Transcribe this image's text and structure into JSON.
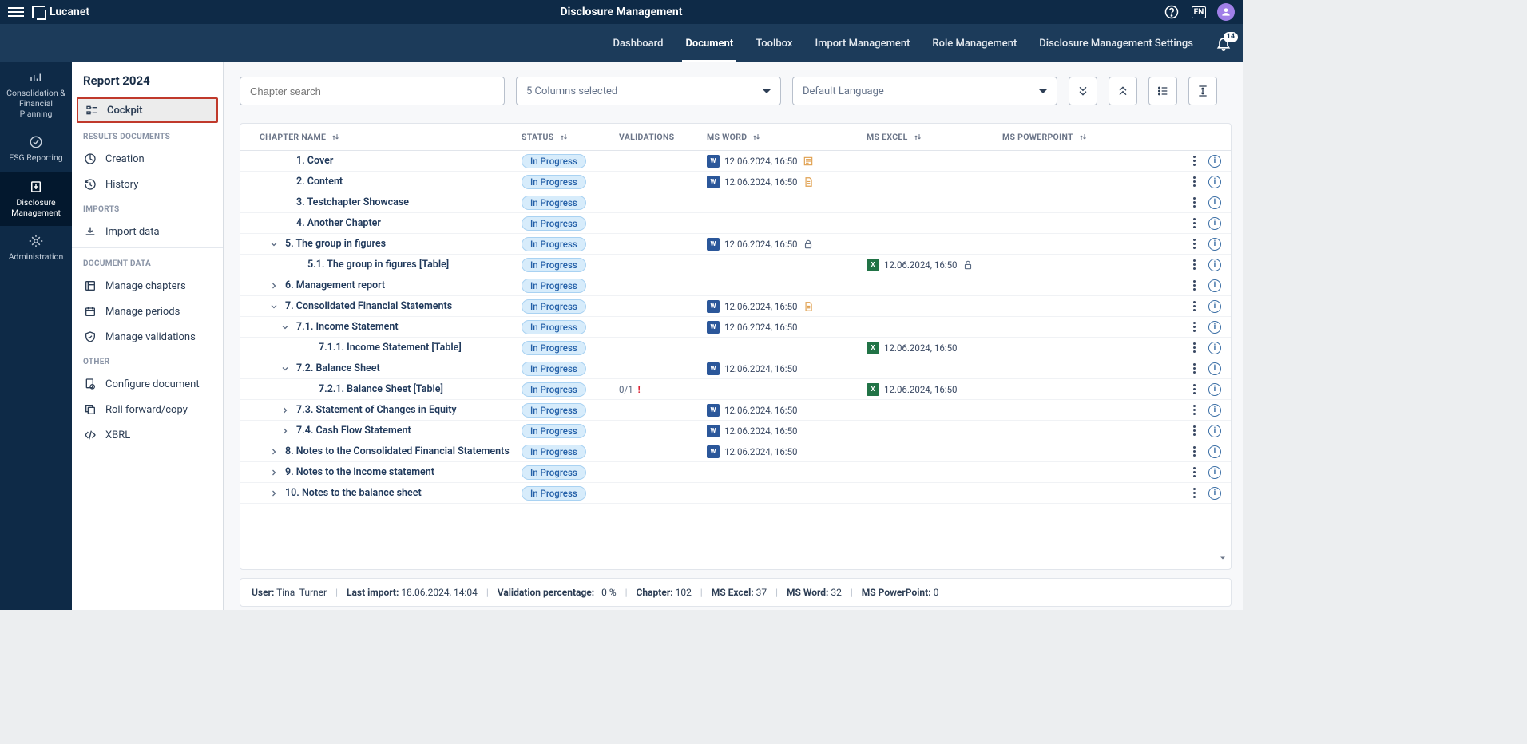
{
  "app": {
    "brand": "Lucanet",
    "title": "Disclosure Management",
    "lang_badge": "EN"
  },
  "vnav": {
    "items": [
      {
        "label": "Consolidation & Financial Planning"
      },
      {
        "label": "ESG Reporting"
      },
      {
        "label": "Disclosure Management"
      },
      {
        "label": "Administration"
      }
    ]
  },
  "subnav": {
    "tabs": [
      {
        "label": "Dashboard"
      },
      {
        "label": "Document"
      },
      {
        "label": "Toolbox"
      },
      {
        "label": "Import Management"
      },
      {
        "label": "Role Management"
      },
      {
        "label": "Disclosure Management Settings"
      }
    ],
    "bell_count": "14"
  },
  "sidepanel": {
    "title": "Report 2024",
    "groups": {
      "g0": {
        "items": [
          {
            "label": "Cockpit"
          }
        ]
      },
      "g1": {
        "head": "RESULTS DOCUMENTS",
        "items": [
          {
            "label": "Creation"
          },
          {
            "label": "History"
          }
        ]
      },
      "g2": {
        "head": "IMPORTS",
        "items": [
          {
            "label": "Import data"
          }
        ]
      },
      "g3": {
        "head": "DOCUMENT DATA",
        "items": [
          {
            "label": "Manage chapters"
          },
          {
            "label": "Manage periods"
          },
          {
            "label": "Manage validations"
          }
        ]
      },
      "g4": {
        "head": "OTHER",
        "items": [
          {
            "label": "Configure document"
          },
          {
            "label": "Roll forward/copy"
          },
          {
            "label": "XBRL"
          }
        ]
      }
    }
  },
  "controls": {
    "search_placeholder": "Chapter search",
    "columns_label": "5 Columns selected",
    "language_label": "Default Language"
  },
  "table": {
    "headers": {
      "name": "CHAPTER NAME",
      "status": "STATUS",
      "valid": "VALIDATIONS",
      "word": "MS WORD",
      "excel": "MS EXCEL",
      "ppt": "MS POWERPOINT"
    },
    "status_label": "In Progress",
    "date": "12.06.2024, 16:50",
    "rows": [
      {
        "indent": 1,
        "chev": "",
        "name": "1. Cover",
        "word": true,
        "word_extra": "lines"
      },
      {
        "indent": 1,
        "chev": "",
        "name": "2. Content",
        "word": true,
        "word_extra": "doc"
      },
      {
        "indent": 1,
        "chev": "",
        "name": "3. Testchapter Showcase"
      },
      {
        "indent": 1,
        "chev": "",
        "name": "4. Another Chapter"
      },
      {
        "indent": 0,
        "chev": "down",
        "name": "5. The group in figures",
        "word": true,
        "word_extra": "lock"
      },
      {
        "indent": 2,
        "chev": "",
        "name": "5.1. The group in figures [Table]",
        "excel": true,
        "excel_extra": "lock"
      },
      {
        "indent": 0,
        "chev": "right",
        "name": "6. Management report"
      },
      {
        "indent": 0,
        "chev": "down",
        "name": "7. Consolidated Financial Statements",
        "word": true,
        "word_extra": "doc"
      },
      {
        "indent": 1,
        "chev": "down",
        "name": "7.1. Income Statement",
        "word": true
      },
      {
        "indent": 3,
        "chev": "",
        "name": "7.1.1. Income Statement [Table]",
        "excel": true
      },
      {
        "indent": 1,
        "chev": "down",
        "name": "7.2. Balance Sheet",
        "word": true
      },
      {
        "indent": 3,
        "chev": "",
        "name": "7.2.1. Balance Sheet [Table]",
        "valid": "0/1",
        "valid_warn": true,
        "excel": true
      },
      {
        "indent": 1,
        "chev": "right",
        "name": "7.3. Statement of Changes in Equity",
        "word": true
      },
      {
        "indent": 1,
        "chev": "right",
        "name": "7.4. Cash Flow Statement",
        "word": true
      },
      {
        "indent": 0,
        "chev": "right",
        "name": "8. Notes to the Consolidated Financial Statements",
        "word": true
      },
      {
        "indent": 0,
        "chev": "right",
        "name": "9. Notes to the income statement"
      },
      {
        "indent": 0,
        "chev": "right",
        "name": "10. Notes to the balance sheet"
      }
    ]
  },
  "footer": {
    "user_label": "User:",
    "user": "Tina_Turner",
    "import_label": "Last import:",
    "import": "18.06.2024, 14:04",
    "valpct_label": "Validation percentage:",
    "valpct": "0 %",
    "chapter_label": "Chapter:",
    "chapter": "102",
    "excel_label": "MS Excel:",
    "excel": "37",
    "word_label": "MS Word:",
    "word": "32",
    "ppt_label": "MS PowerPoint:",
    "ppt": "0"
  }
}
